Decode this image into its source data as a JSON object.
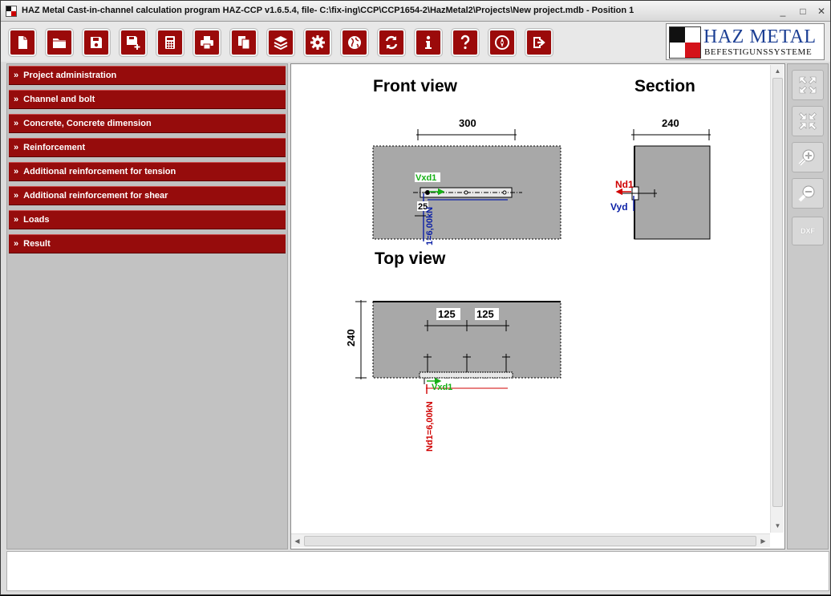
{
  "window": {
    "title": "HAZ Metal Cast-in-channel calculation program HAZ-CCP v1.6.5.4, file- C:\\fix-ing\\CCP\\CCP1654-2\\HazMetal2\\Projects\\New project.mdb - Position 1",
    "controls": {
      "minimize": "_",
      "maximize": "□",
      "close": "✕"
    }
  },
  "toolbar": {
    "buttons": [
      {
        "name": "new-button",
        "icon": "new-file-icon"
      },
      {
        "name": "open-button",
        "icon": "folder-icon"
      },
      {
        "name": "save-button",
        "icon": "floppy-icon"
      },
      {
        "name": "save-as-button",
        "icon": "floppy-plus-icon"
      },
      {
        "name": "calculate-button",
        "icon": "calculator-icon"
      },
      {
        "name": "print-button",
        "icon": "printer-icon"
      },
      {
        "name": "copy-button",
        "icon": "copy-icon"
      },
      {
        "name": "layers-button",
        "icon": "layers-icon"
      },
      {
        "name": "settings-button",
        "icon": "gear-icon"
      },
      {
        "name": "language-button",
        "icon": "globe-icon"
      },
      {
        "name": "refresh-button",
        "icon": "refresh-icon"
      },
      {
        "name": "info-button",
        "icon": "info-icon"
      },
      {
        "name": "help-button",
        "icon": "question-icon"
      },
      {
        "name": "compass-button",
        "icon": "compass-icon"
      },
      {
        "name": "exit-button",
        "icon": "exit-icon"
      }
    ]
  },
  "logo": {
    "name": "HAZ METAL",
    "subtitle": "BEFESTIGUNSSYSTEME"
  },
  "sidebar": {
    "items": [
      {
        "label": "Project administration"
      },
      {
        "label": "Channel and bolt"
      },
      {
        "label": "Concrete, Concrete dimension"
      },
      {
        "label": "Reinforcement"
      },
      {
        "label": "Additional reinforcement for tension"
      },
      {
        "label": "Additional reinforcement for shear"
      },
      {
        "label": "Loads"
      },
      {
        "label": "Result"
      }
    ],
    "chevron": "»"
  },
  "drawing": {
    "front_view_title": "Front view",
    "section_title": "Section",
    "top_view_title": "Top view",
    "front_width": "300",
    "section_width": "240",
    "top_depth": "240",
    "spacing_1": "125",
    "spacing_2": "125",
    "front_edge_dist": "25",
    "label_vxd1": "Vxd1",
    "label_nd1": "Nd1",
    "label_vyd": "Vyd",
    "label_nd1_value": "Nd1=6,00kN",
    "label_front_load": "1=6,00kN",
    "colors": {
      "concrete": "#a8a8a8",
      "tension": "#d00000",
      "shear_x": "#16b016",
      "shear_y": "#0a1fa6"
    }
  },
  "right_panel": {
    "buttons": [
      {
        "name": "fit-view-button",
        "icon": "expand-icon"
      },
      {
        "name": "shrink-view-button",
        "icon": "shrink-icon"
      },
      {
        "name": "zoom-in-button",
        "icon": "zoom-in-icon"
      },
      {
        "name": "zoom-out-button",
        "icon": "zoom-out-icon"
      },
      {
        "name": "dxf-export-button",
        "label": "DXF"
      }
    ]
  },
  "status": {
    "text": ""
  }
}
